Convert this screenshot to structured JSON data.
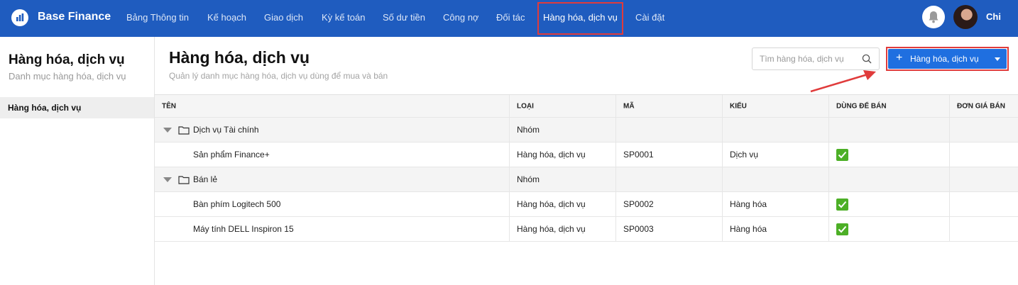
{
  "app": {
    "brand": "Base Finance",
    "user_name": "Chi"
  },
  "nav": {
    "items": [
      {
        "label": "Bảng Thông tin"
      },
      {
        "label": "Kế hoạch"
      },
      {
        "label": "Giao dịch"
      },
      {
        "label": "Kỳ kế toán"
      },
      {
        "label": "Số dư tiền"
      },
      {
        "label": "Công nợ"
      },
      {
        "label": "Đối tác"
      },
      {
        "label": "Hàng hóa, dịch vụ",
        "active": true
      },
      {
        "label": "Cài đặt"
      }
    ]
  },
  "sidebar": {
    "title": "Hàng hóa, dịch vụ",
    "subtitle": "Danh mục hàng hóa, dịch vụ",
    "items": [
      {
        "label": "Hàng hóa, dịch vụ",
        "selected": true
      }
    ]
  },
  "main": {
    "title": "Hàng hóa, dịch vụ",
    "subtitle": "Quản lý danh mục hàng hóa, dịch vụ dùng để mua và bán",
    "search_placeholder": "Tìm hàng hóa, dịch vụ",
    "add_button_label": "Hàng hóa, dịch vụ"
  },
  "table": {
    "columns": [
      "TÊN",
      "LOẠI",
      "MÃ",
      "KIỂU",
      "DÙNG ĐỂ BÁN",
      "ĐƠN GIÁ BÁN"
    ],
    "rows": [
      {
        "kind": "group",
        "name": "Dịch vụ Tài chính",
        "type": "Nhóm",
        "code": "",
        "style": "",
        "for_sale": false,
        "price": ""
      },
      {
        "kind": "item",
        "name": "Sản phẩm Finance+",
        "type": "Hàng hóa, dịch vụ",
        "code": "SP0001",
        "style": "Dịch vụ",
        "for_sale": true,
        "price": ""
      },
      {
        "kind": "group",
        "name": "Bán lẻ",
        "type": "Nhóm",
        "code": "",
        "style": "",
        "for_sale": false,
        "price": ""
      },
      {
        "kind": "item",
        "name": "Bàn phím Logitech 500",
        "type": "Hàng hóa, dịch vụ",
        "code": "SP0002",
        "style": "Hàng hóa",
        "for_sale": true,
        "price": ""
      },
      {
        "kind": "item",
        "name": "Máy tính DELL Inspiron 15",
        "type": "Hàng hóa, dịch vụ",
        "code": "SP0003",
        "style": "Hàng hóa",
        "for_sale": true,
        "price": ""
      }
    ]
  },
  "colors": {
    "topbar": "#1f5cbf",
    "primary_button": "#1f6fe0",
    "highlight": "#e03b3b",
    "check": "#4caf26"
  }
}
